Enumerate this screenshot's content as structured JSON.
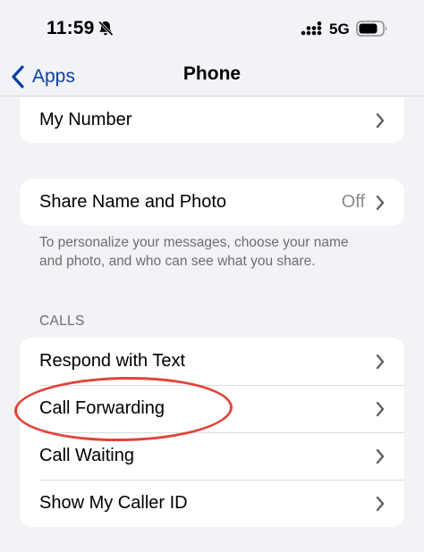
{
  "status_bar": {
    "time": "11:59",
    "network": "5G",
    "icons": [
      "bell-slash-icon",
      "signal-icon",
      "battery-icon"
    ]
  },
  "nav": {
    "back_label": "Apps",
    "title": "Phone"
  },
  "groups": {
    "my_number": {
      "label": "My Number"
    },
    "share": {
      "label": "Share Name and Photo",
      "value": "Off"
    }
  },
  "share_footnote": "To personalize your messages, choose your name and photo, and who can see what you share.",
  "calls": {
    "header": "CALLS",
    "items": [
      {
        "label": "Respond with Text"
      },
      {
        "label": "Call Forwarding"
      },
      {
        "label": "Call Waiting"
      },
      {
        "label": "Show My Caller ID"
      }
    ]
  },
  "colors": {
    "background": "#f2f2f7",
    "link_blue": "#0a3fa8",
    "annotation_red": "#e0453a",
    "secondary_text": "#6d6d72"
  }
}
